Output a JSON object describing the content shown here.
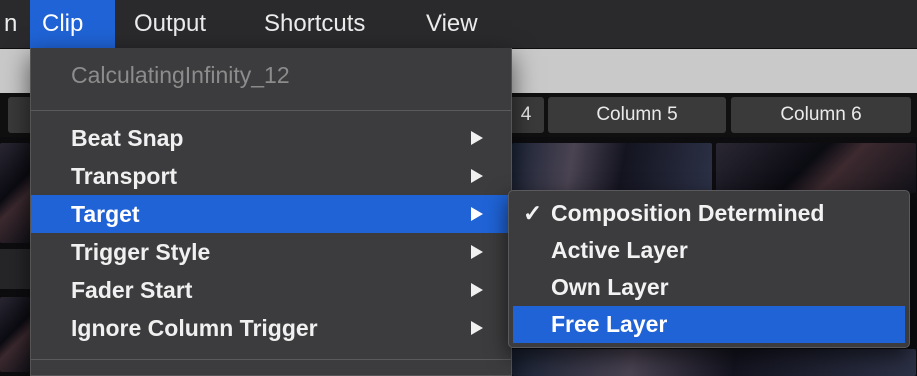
{
  "menubar": {
    "partial_label": "n",
    "items": [
      {
        "label": "Clip"
      },
      {
        "label": "Output"
      },
      {
        "label": "Shortcuts"
      },
      {
        "label": "View"
      }
    ]
  },
  "background": {
    "column_partial": "4",
    "columns": [
      "Column 5",
      "Column 6"
    ]
  },
  "clip_menu": {
    "clip_name": "CalculatingInfinity_12",
    "items": [
      {
        "label": "Beat Snap"
      },
      {
        "label": "Transport"
      },
      {
        "label": "Target"
      },
      {
        "label": "Trigger Style"
      },
      {
        "label": "Fader Start"
      },
      {
        "label": "Ignore Column Trigger"
      }
    ],
    "highlighted": "Target"
  },
  "target_submenu": {
    "check_glyph": "✓",
    "items": [
      {
        "label": "Composition Determined",
        "checked": true
      },
      {
        "label": "Active Layer",
        "checked": false
      },
      {
        "label": "Own Layer",
        "checked": false
      },
      {
        "label": "Free Layer",
        "checked": false
      }
    ],
    "highlighted": "Free Layer"
  },
  "colors": {
    "highlight": "#1f63d6",
    "menu_bg": "#3c3c3e",
    "menubar_bg": "#2a2a2c"
  }
}
